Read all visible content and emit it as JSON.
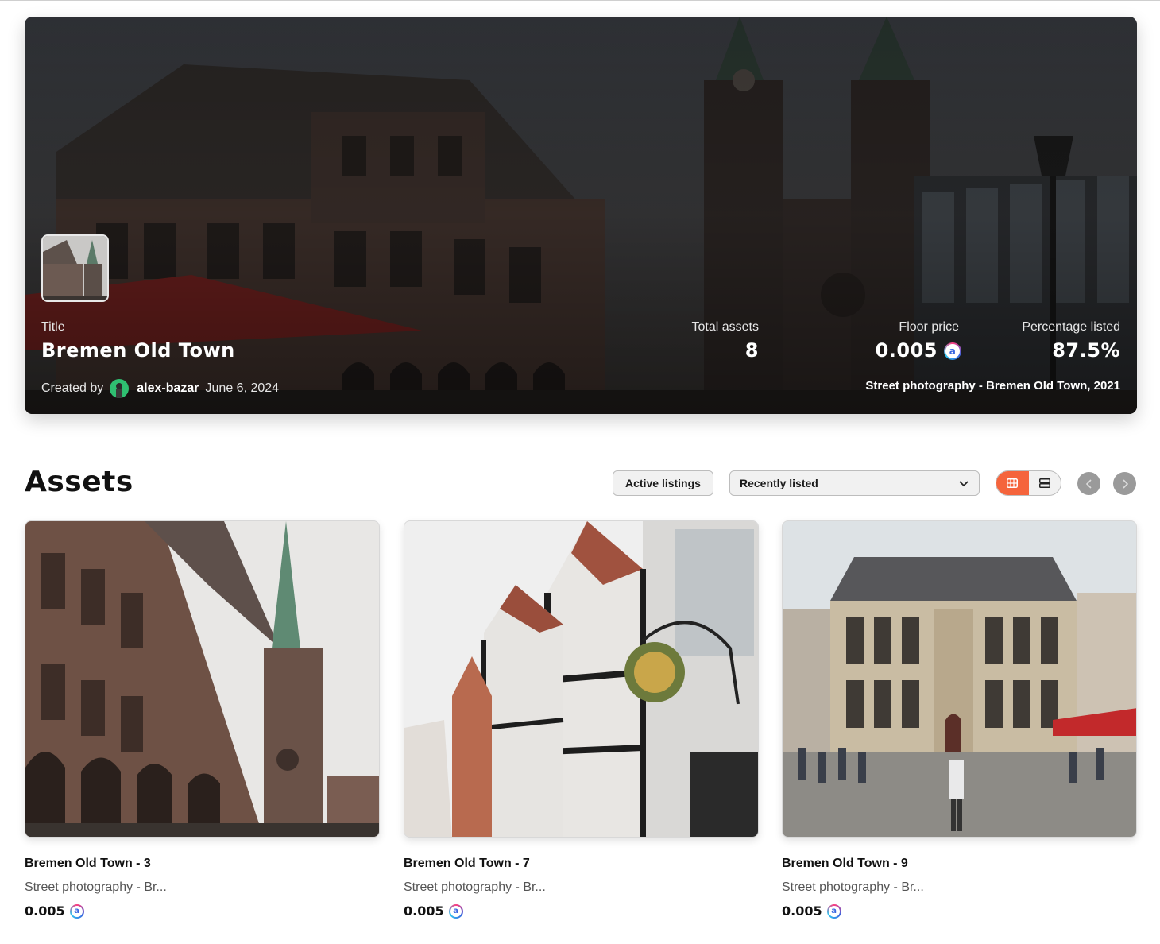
{
  "collection": {
    "title_label": "Title",
    "title": "Bremen Old Town",
    "created_by_label": "Created by",
    "creator": "alex-bazar",
    "date": "June 6, 2024",
    "description": "Street photography - Bremen Old Town, 2021",
    "stats": {
      "total_assets_label": "Total assets",
      "total_assets": "8",
      "floor_price_label": "Floor price",
      "floor_price": "0.005",
      "percentage_listed_label": "Percentage listed",
      "percentage_listed": "87.5%"
    },
    "currency_glyph": "a"
  },
  "assets": {
    "heading": "Assets",
    "filter_button": "Active listings",
    "sort_selected": "Recently listed",
    "view_modes": [
      "grid-icon",
      "list-icon"
    ],
    "active_view": "grid",
    "accent_color": "#f5643c",
    "items": [
      {
        "name": "Bremen Old Town - 3",
        "description": "Street photography - Br...",
        "price": "0.005"
      },
      {
        "name": "Bremen Old Town - 7",
        "description": "Street photography - Br...",
        "price": "0.005"
      },
      {
        "name": "Bremen Old Town - 9",
        "description": "Street photography - Br...",
        "price": "0.005"
      }
    ]
  }
}
